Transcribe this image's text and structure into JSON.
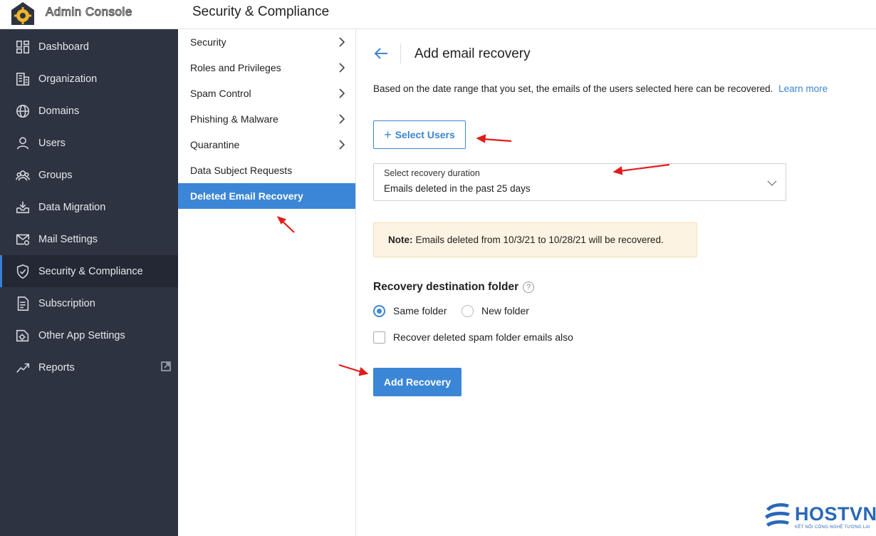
{
  "header": {
    "app_name": "Admin Console",
    "page_heading": "Security & Compliance"
  },
  "sidebar": {
    "items": [
      {
        "label": "Dashboard",
        "icon": "dashboard-icon"
      },
      {
        "label": "Organization",
        "icon": "building-icon"
      },
      {
        "label": "Domains",
        "icon": "globe-icon"
      },
      {
        "label": "Users",
        "icon": "user-icon"
      },
      {
        "label": "Groups",
        "icon": "groups-icon"
      },
      {
        "label": "Data Migration",
        "icon": "download-tray-icon"
      },
      {
        "label": "Mail Settings",
        "icon": "mail-settings-icon"
      },
      {
        "label": "Security & Compliance",
        "icon": "shield-check-icon"
      },
      {
        "label": "Subscription",
        "icon": "document-icon"
      },
      {
        "label": "Other App Settings",
        "icon": "app-settings-icon"
      },
      {
        "label": "Reports",
        "icon": "trend-chart-icon"
      }
    ],
    "active": "Security & Compliance"
  },
  "submenu": {
    "items": [
      {
        "label": "Security"
      },
      {
        "label": "Roles and Privileges"
      },
      {
        "label": "Spam Control"
      },
      {
        "label": "Phishing & Malware"
      },
      {
        "label": "Quarantine"
      },
      {
        "label": "Data Subject Requests"
      },
      {
        "label": "Deleted Email Recovery"
      }
    ],
    "active": "Deleted Email Recovery"
  },
  "main": {
    "title": "Add email recovery",
    "description": "Based on the date range that you set, the emails of the users selected here can be recovered.",
    "learn_more": "Learn more",
    "select_users_label": "Select Users",
    "dropdown": {
      "label": "Select recovery duration",
      "value": "Emails deleted in the past 25 days"
    },
    "note": {
      "prefix": "Note:",
      "text": "Emails deleted from 10/3/21 to 10/28/21 will be recovered."
    },
    "destination": {
      "title": "Recovery destination folder",
      "help": "?",
      "options": [
        {
          "label": "Same folder",
          "checked": true
        },
        {
          "label": "New folder",
          "checked": false
        }
      ],
      "spam_checkbox": {
        "label": "Recover deleted spam folder emails also",
        "checked": false
      }
    },
    "add_button": "Add Recovery"
  },
  "annotation_color": "#e31b1b",
  "accent_color": "#3b86d6",
  "brand": {
    "name": "HOSTVN",
    "tagline": "KẾT NỐI CÔNG NGHỆ TƯƠNG LAI"
  }
}
